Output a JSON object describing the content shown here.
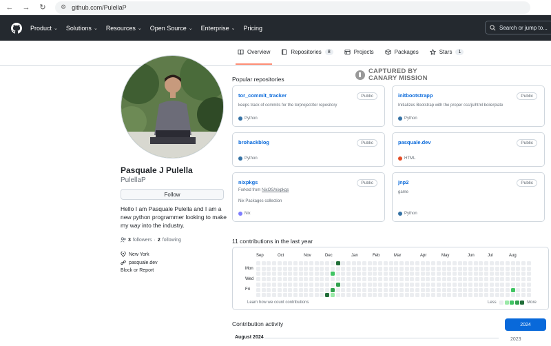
{
  "browser": {
    "url": "github.com/PulellaP"
  },
  "header": {
    "nav": [
      "Product",
      "Solutions",
      "Resources",
      "Open Source",
      "Enterprise",
      "Pricing"
    ],
    "search_placeholder": "Search or jump to..."
  },
  "tabs": [
    {
      "label": "Overview",
      "count": "",
      "icon": "book-icon"
    },
    {
      "label": "Repositories",
      "count": "8",
      "icon": "repo-icon"
    },
    {
      "label": "Projects",
      "count": "",
      "icon": "table-icon"
    },
    {
      "label": "Packages",
      "count": "",
      "icon": "package-icon"
    },
    {
      "label": "Stars",
      "count": "1",
      "icon": "star-icon"
    }
  ],
  "profile": {
    "name": "Pasquale J Pulella",
    "login": "PulellaP",
    "follow_label": "Follow",
    "bio": "Hello I am Pasquale Pulella and I am a new python programmer looking to make my way into the industry.",
    "followers_count": "3",
    "followers_label": "followers",
    "separator": "·",
    "following_count": "2",
    "following_label": "following",
    "location": "New York",
    "website": "pasquale.dev",
    "block_label": "Block or Report"
  },
  "watermark": {
    "line1": "CAPTURED BY",
    "line2": "CANARY MISSION"
  },
  "popular": {
    "title": "Popular repositories",
    "repos": [
      {
        "name": "tor_commit_tracker",
        "visibility": "Public",
        "description": "keeps track of commits for the torproject/tor repository",
        "fork_prefix": "",
        "fork_source": "",
        "language": "Python",
        "lang_color": "#3572A5"
      },
      {
        "name": "initbootstrapp",
        "visibility": "Public",
        "description": "Initializes Bootstrap with the proper css/js/html boilerplate",
        "fork_prefix": "",
        "fork_source": "",
        "language": "Python",
        "lang_color": "#3572A5"
      },
      {
        "name": "brohackblog",
        "visibility": "Public",
        "description": "",
        "fork_prefix": "",
        "fork_source": "",
        "language": "Python",
        "lang_color": "#3572A5"
      },
      {
        "name": "pasquale.dev",
        "visibility": "Public",
        "description": "",
        "fork_prefix": "",
        "fork_source": "",
        "language": "HTML",
        "lang_color": "#e34c26"
      },
      {
        "name": "nixpkgs",
        "visibility": "Public",
        "description": "Nix Packages collection",
        "fork_prefix": "Forked from ",
        "fork_source": "NixOS/nixpkgs",
        "language": "Nix",
        "lang_color": "#7e7eff"
      },
      {
        "name": "jnp2",
        "visibility": "Public",
        "description": "game",
        "fork_prefix": "",
        "fork_source": "",
        "language": "Python",
        "lang_color": "#3572A5"
      }
    ]
  },
  "contributions": {
    "title": "11 contributions in the last year",
    "months": [
      "Sep",
      "Oct",
      "Nov",
      "Dec",
      "Jan",
      "Feb",
      "Mar",
      "Apr",
      "May",
      "Jun",
      "Jul",
      "Aug"
    ],
    "days": [
      "Mon",
      "Wed",
      "Fri"
    ],
    "learn_label": "Learn how we count contributions",
    "less_label": "Less",
    "more_label": "More",
    "colors": [
      "#ebedf0",
      "#9be9a8",
      "#40c463",
      "#30a14e",
      "#216e39"
    ]
  },
  "activity": {
    "title": "Contribution activity",
    "selected_year": "2024",
    "other_year": "2023",
    "month_label": "August 2024"
  }
}
